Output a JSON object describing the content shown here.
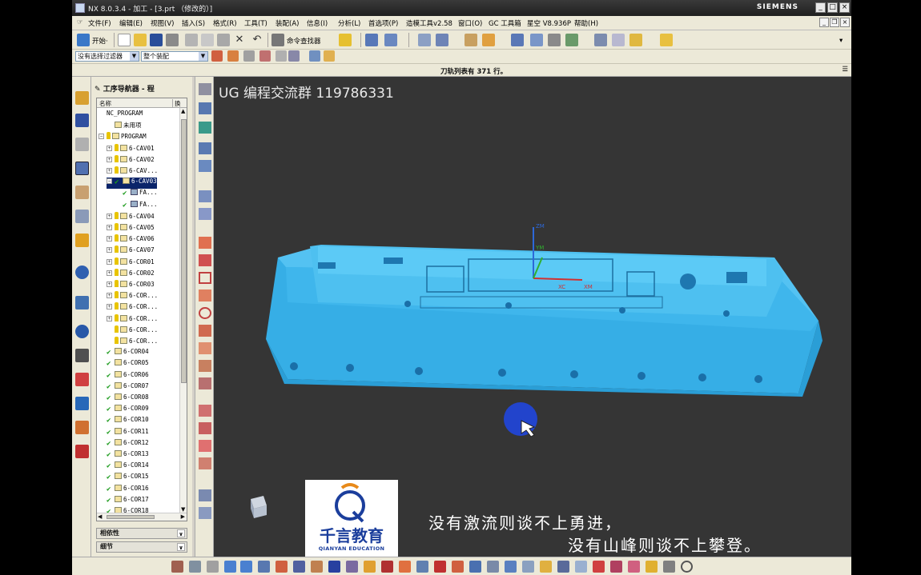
{
  "window": {
    "title": "NX 8.0.3.4 - 加工 - [3.prt （修改的）]",
    "brand": "SIEMENS"
  },
  "menu": {
    "items": [
      "文件(F)",
      "编辑(E)",
      "视图(V)",
      "插入(S)",
      "格式(R)",
      "工具(T)",
      "装配(A)",
      "信息(I)",
      "分析(L)",
      "首选项(P)",
      "造模工具v2.58",
      "窗口(O)",
      "GC 工具箱",
      "星空 V8.936P",
      "帮助(H)"
    ]
  },
  "toolbar": {
    "start_label": "开始·",
    "command_finder_label": "命令查找器",
    "filter_select": "没有选择过滤器",
    "assembly_select": "整个装配"
  },
  "status": {
    "text": "刀轨列表有 371 行。"
  },
  "navigator": {
    "title": "工序导航器 - 程",
    "col_name": "名称",
    "col_other": "换",
    "rows": [
      {
        "indent": 0,
        "exp": "",
        "icon": "none",
        "check": false,
        "key": false,
        "label": "NC_PROGRAM"
      },
      {
        "indent": 1,
        "exp": "",
        "icon": "prog",
        "check": false,
        "key": false,
        "label": "未用项"
      },
      {
        "indent": 0,
        "exp": "−",
        "icon": "prog",
        "check": false,
        "key": true,
        "label": "PROGRAM"
      },
      {
        "indent": 1,
        "exp": "+",
        "icon": "prog",
        "check": false,
        "key": true,
        "label": "6-CAV01"
      },
      {
        "indent": 1,
        "exp": "+",
        "icon": "prog",
        "check": false,
        "key": true,
        "label": "6-CAV02"
      },
      {
        "indent": 1,
        "exp": "+",
        "icon": "prog",
        "check": false,
        "key": true,
        "label": "6-CAV..."
      },
      {
        "indent": 1,
        "exp": "−",
        "icon": "prog",
        "check": true,
        "key": false,
        "label": "6-CAV03",
        "selected": true
      },
      {
        "indent": 2,
        "exp": "",
        "icon": "op",
        "check": true,
        "key": false,
        "label": "FA..."
      },
      {
        "indent": 2,
        "exp": "",
        "icon": "op",
        "check": true,
        "key": false,
        "label": "FA..."
      },
      {
        "indent": 1,
        "exp": "+",
        "icon": "prog",
        "check": false,
        "key": true,
        "label": "6-CAV04"
      },
      {
        "indent": 1,
        "exp": "+",
        "icon": "prog",
        "check": false,
        "key": true,
        "label": "6-CAV05"
      },
      {
        "indent": 1,
        "exp": "+",
        "icon": "prog",
        "check": false,
        "key": true,
        "label": "6-CAV06"
      },
      {
        "indent": 1,
        "exp": "+",
        "icon": "prog",
        "check": false,
        "key": true,
        "label": "6-CAV07"
      },
      {
        "indent": 1,
        "exp": "+",
        "icon": "prog",
        "check": false,
        "key": true,
        "label": "6-COR01"
      },
      {
        "indent": 1,
        "exp": "+",
        "icon": "prog",
        "check": false,
        "key": true,
        "label": "6-COR02"
      },
      {
        "indent": 1,
        "exp": "+",
        "icon": "prog",
        "check": false,
        "key": true,
        "label": "6-COR03"
      },
      {
        "indent": 1,
        "exp": "+",
        "icon": "prog",
        "check": false,
        "key": true,
        "label": "6-COR..."
      },
      {
        "indent": 1,
        "exp": "+",
        "icon": "prog",
        "check": false,
        "key": true,
        "label": "6-COR..."
      },
      {
        "indent": 1,
        "exp": "+",
        "icon": "prog",
        "check": false,
        "key": true,
        "label": "6-COR..."
      },
      {
        "indent": 1,
        "exp": "",
        "icon": "prog",
        "check": false,
        "key": true,
        "label": "6-COR..."
      },
      {
        "indent": 1,
        "exp": "",
        "icon": "prog",
        "check": false,
        "key": true,
        "label": "6-COR..."
      },
      {
        "indent": 0,
        "exp": "",
        "icon": "prog",
        "check": true,
        "key": false,
        "label": "6-COR04"
      },
      {
        "indent": 0,
        "exp": "",
        "icon": "prog",
        "check": true,
        "key": false,
        "label": "6-COR05"
      },
      {
        "indent": 0,
        "exp": "",
        "icon": "prog",
        "check": true,
        "key": false,
        "label": "6-COR06"
      },
      {
        "indent": 0,
        "exp": "",
        "icon": "prog",
        "check": true,
        "key": false,
        "label": "6-COR07"
      },
      {
        "indent": 0,
        "exp": "",
        "icon": "prog",
        "check": true,
        "key": false,
        "label": "6-COR08"
      },
      {
        "indent": 0,
        "exp": "",
        "icon": "prog",
        "check": true,
        "key": false,
        "label": "6-COR09"
      },
      {
        "indent": 0,
        "exp": "",
        "icon": "prog",
        "check": true,
        "key": false,
        "label": "6-COR10"
      },
      {
        "indent": 0,
        "exp": "",
        "icon": "prog",
        "check": true,
        "key": false,
        "label": "6-COR11"
      },
      {
        "indent": 0,
        "exp": "",
        "icon": "prog",
        "check": true,
        "key": false,
        "label": "6-COR12"
      },
      {
        "indent": 0,
        "exp": "",
        "icon": "prog",
        "check": true,
        "key": false,
        "label": "6-COR13"
      },
      {
        "indent": 0,
        "exp": "",
        "icon": "prog",
        "check": true,
        "key": false,
        "label": "6-COR14"
      },
      {
        "indent": 0,
        "exp": "",
        "icon": "prog",
        "check": true,
        "key": false,
        "label": "6-COR15"
      },
      {
        "indent": 0,
        "exp": "",
        "icon": "prog",
        "check": true,
        "key": false,
        "label": "6-COR16"
      },
      {
        "indent": 0,
        "exp": "",
        "icon": "prog",
        "check": true,
        "key": false,
        "label": "6-COR17"
      },
      {
        "indent": 0,
        "exp": "",
        "icon": "prog",
        "check": true,
        "key": false,
        "label": "6-COR18"
      }
    ],
    "dependency_label": "相依性",
    "details_label": "细节"
  },
  "viewport": {
    "overlay": "UG 编程交流群 119786331",
    "subtitle_line1": "没有激流则谈不上勇进，",
    "subtitle_line2": "没有山峰则谈不上攀登。",
    "logo_cn": "千言教育",
    "logo_en": "QIANYAN EDUCATION",
    "axis_labels": {
      "zm": "ZM",
      "ym": "YM",
      "xc": "XC",
      "xm": "XM"
    },
    "model_color": "#3ab4ea",
    "background_color": "#353535"
  }
}
